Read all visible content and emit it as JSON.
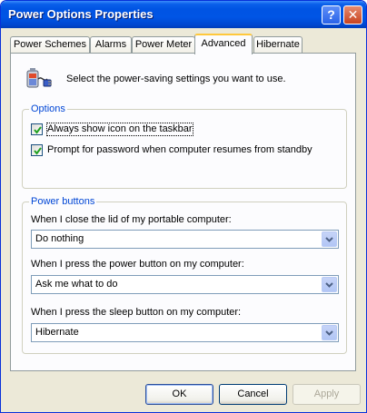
{
  "window": {
    "title": "Power Options Properties",
    "help_glyph": "?",
    "close_glyph": "✕"
  },
  "tabs": [
    {
      "label": "Power Schemes",
      "active": false
    },
    {
      "label": "Alarms",
      "active": false
    },
    {
      "label": "Power Meter",
      "active": false
    },
    {
      "label": "Advanced",
      "active": true
    },
    {
      "label": "Hibernate",
      "active": false
    }
  ],
  "intro": {
    "text": "Select the power-saving settings you want to use.",
    "icon": "power-plug-battery-icon"
  },
  "options": {
    "legend": "Options",
    "always_show_icon": {
      "label": "Always show icon on the taskbar",
      "checked": true
    },
    "prompt_password": {
      "label": "Prompt for password when computer resumes from standby",
      "checked": true
    }
  },
  "power_buttons": {
    "legend": "Power buttons",
    "lid": {
      "label": "When I close the lid of my portable computer:",
      "value": "Do nothing"
    },
    "power": {
      "label": "When I press the power button on my computer:",
      "value": "Ask me what to do"
    },
    "sleep": {
      "label": "When I press the sleep button on my computer:",
      "value": "Hibernate"
    }
  },
  "buttons": {
    "ok": "OK",
    "cancel": "Cancel",
    "apply": "Apply"
  },
  "colors": {
    "titlebar": "#0054e3",
    "group_legend": "#0046d5",
    "checkmark": "#21a121"
  }
}
